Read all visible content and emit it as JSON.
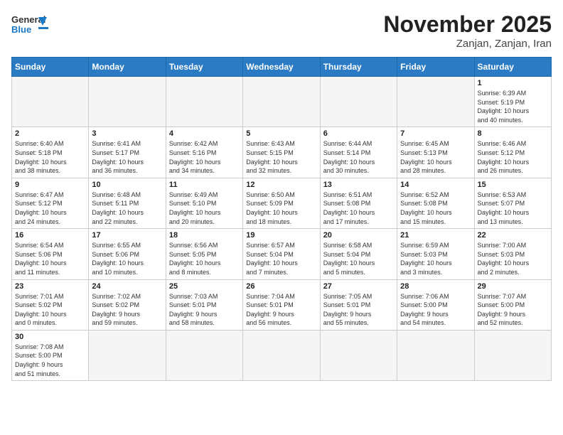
{
  "header": {
    "logo_text_general": "General",
    "logo_text_blue": "Blue",
    "month_title": "November 2025",
    "location": "Zanjan, Zanjan, Iran"
  },
  "weekdays": [
    "Sunday",
    "Monday",
    "Tuesday",
    "Wednesday",
    "Thursday",
    "Friday",
    "Saturday"
  ],
  "weeks": [
    [
      {
        "day": "",
        "info": ""
      },
      {
        "day": "",
        "info": ""
      },
      {
        "day": "",
        "info": ""
      },
      {
        "day": "",
        "info": ""
      },
      {
        "day": "",
        "info": ""
      },
      {
        "day": "",
        "info": ""
      },
      {
        "day": "1",
        "info": "Sunrise: 6:39 AM\nSunset: 5:19 PM\nDaylight: 10 hours\nand 40 minutes."
      }
    ],
    [
      {
        "day": "2",
        "info": "Sunrise: 6:40 AM\nSunset: 5:18 PM\nDaylight: 10 hours\nand 38 minutes."
      },
      {
        "day": "3",
        "info": "Sunrise: 6:41 AM\nSunset: 5:17 PM\nDaylight: 10 hours\nand 36 minutes."
      },
      {
        "day": "4",
        "info": "Sunrise: 6:42 AM\nSunset: 5:16 PM\nDaylight: 10 hours\nand 34 minutes."
      },
      {
        "day": "5",
        "info": "Sunrise: 6:43 AM\nSunset: 5:15 PM\nDaylight: 10 hours\nand 32 minutes."
      },
      {
        "day": "6",
        "info": "Sunrise: 6:44 AM\nSunset: 5:14 PM\nDaylight: 10 hours\nand 30 minutes."
      },
      {
        "day": "7",
        "info": "Sunrise: 6:45 AM\nSunset: 5:13 PM\nDaylight: 10 hours\nand 28 minutes."
      },
      {
        "day": "8",
        "info": "Sunrise: 6:46 AM\nSunset: 5:12 PM\nDaylight: 10 hours\nand 26 minutes."
      }
    ],
    [
      {
        "day": "9",
        "info": "Sunrise: 6:47 AM\nSunset: 5:12 PM\nDaylight: 10 hours\nand 24 minutes."
      },
      {
        "day": "10",
        "info": "Sunrise: 6:48 AM\nSunset: 5:11 PM\nDaylight: 10 hours\nand 22 minutes."
      },
      {
        "day": "11",
        "info": "Sunrise: 6:49 AM\nSunset: 5:10 PM\nDaylight: 10 hours\nand 20 minutes."
      },
      {
        "day": "12",
        "info": "Sunrise: 6:50 AM\nSunset: 5:09 PM\nDaylight: 10 hours\nand 18 minutes."
      },
      {
        "day": "13",
        "info": "Sunrise: 6:51 AM\nSunset: 5:08 PM\nDaylight: 10 hours\nand 17 minutes."
      },
      {
        "day": "14",
        "info": "Sunrise: 6:52 AM\nSunset: 5:08 PM\nDaylight: 10 hours\nand 15 minutes."
      },
      {
        "day": "15",
        "info": "Sunrise: 6:53 AM\nSunset: 5:07 PM\nDaylight: 10 hours\nand 13 minutes."
      }
    ],
    [
      {
        "day": "16",
        "info": "Sunrise: 6:54 AM\nSunset: 5:06 PM\nDaylight: 10 hours\nand 11 minutes."
      },
      {
        "day": "17",
        "info": "Sunrise: 6:55 AM\nSunset: 5:06 PM\nDaylight: 10 hours\nand 10 minutes."
      },
      {
        "day": "18",
        "info": "Sunrise: 6:56 AM\nSunset: 5:05 PM\nDaylight: 10 hours\nand 8 minutes."
      },
      {
        "day": "19",
        "info": "Sunrise: 6:57 AM\nSunset: 5:04 PM\nDaylight: 10 hours\nand 7 minutes."
      },
      {
        "day": "20",
        "info": "Sunrise: 6:58 AM\nSunset: 5:04 PM\nDaylight: 10 hours\nand 5 minutes."
      },
      {
        "day": "21",
        "info": "Sunrise: 6:59 AM\nSunset: 5:03 PM\nDaylight: 10 hours\nand 3 minutes."
      },
      {
        "day": "22",
        "info": "Sunrise: 7:00 AM\nSunset: 5:03 PM\nDaylight: 10 hours\nand 2 minutes."
      }
    ],
    [
      {
        "day": "23",
        "info": "Sunrise: 7:01 AM\nSunset: 5:02 PM\nDaylight: 10 hours\nand 0 minutes."
      },
      {
        "day": "24",
        "info": "Sunrise: 7:02 AM\nSunset: 5:02 PM\nDaylight: 9 hours\nand 59 minutes."
      },
      {
        "day": "25",
        "info": "Sunrise: 7:03 AM\nSunset: 5:01 PM\nDaylight: 9 hours\nand 58 minutes."
      },
      {
        "day": "26",
        "info": "Sunrise: 7:04 AM\nSunset: 5:01 PM\nDaylight: 9 hours\nand 56 minutes."
      },
      {
        "day": "27",
        "info": "Sunrise: 7:05 AM\nSunset: 5:01 PM\nDaylight: 9 hours\nand 55 minutes."
      },
      {
        "day": "28",
        "info": "Sunrise: 7:06 AM\nSunset: 5:00 PM\nDaylight: 9 hours\nand 54 minutes."
      },
      {
        "day": "29",
        "info": "Sunrise: 7:07 AM\nSunset: 5:00 PM\nDaylight: 9 hours\nand 52 minutes."
      }
    ],
    [
      {
        "day": "30",
        "info": "Sunrise: 7:08 AM\nSunset: 5:00 PM\nDaylight: 9 hours\nand 51 minutes."
      },
      {
        "day": "",
        "info": ""
      },
      {
        "day": "",
        "info": ""
      },
      {
        "day": "",
        "info": ""
      },
      {
        "day": "",
        "info": ""
      },
      {
        "day": "",
        "info": ""
      },
      {
        "day": "",
        "info": ""
      }
    ]
  ]
}
